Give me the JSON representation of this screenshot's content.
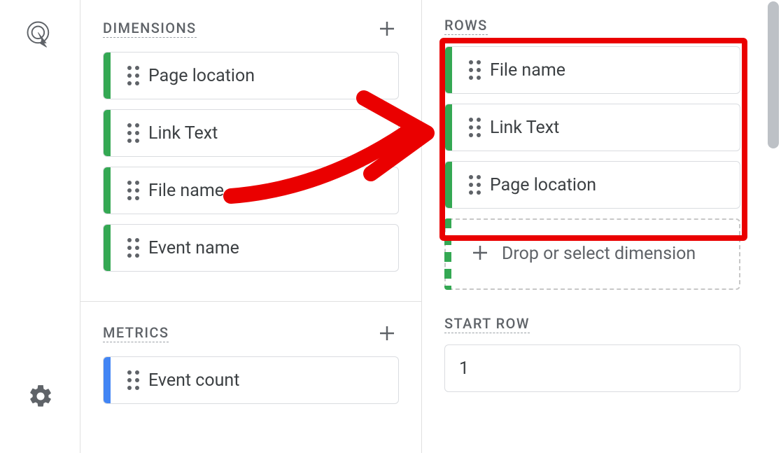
{
  "sidebar": {
    "tool_icon": "click-target-icon",
    "settings_icon": "gear-icon"
  },
  "dimensions": {
    "label": "DIMENSIONS",
    "items": [
      {
        "label": "Page location"
      },
      {
        "label": "Link Text"
      },
      {
        "label": "File name"
      },
      {
        "label": "Event name"
      }
    ]
  },
  "metrics": {
    "label": "METRICS",
    "items": [
      {
        "label": "Event count"
      }
    ]
  },
  "rows": {
    "label": "ROWS",
    "items": [
      {
        "label": "File name"
      },
      {
        "label": "Link Text"
      },
      {
        "label": "Page location"
      }
    ],
    "drop_label": "Drop or select dimension"
  },
  "start_row": {
    "label": "START ROW",
    "value": "1"
  }
}
